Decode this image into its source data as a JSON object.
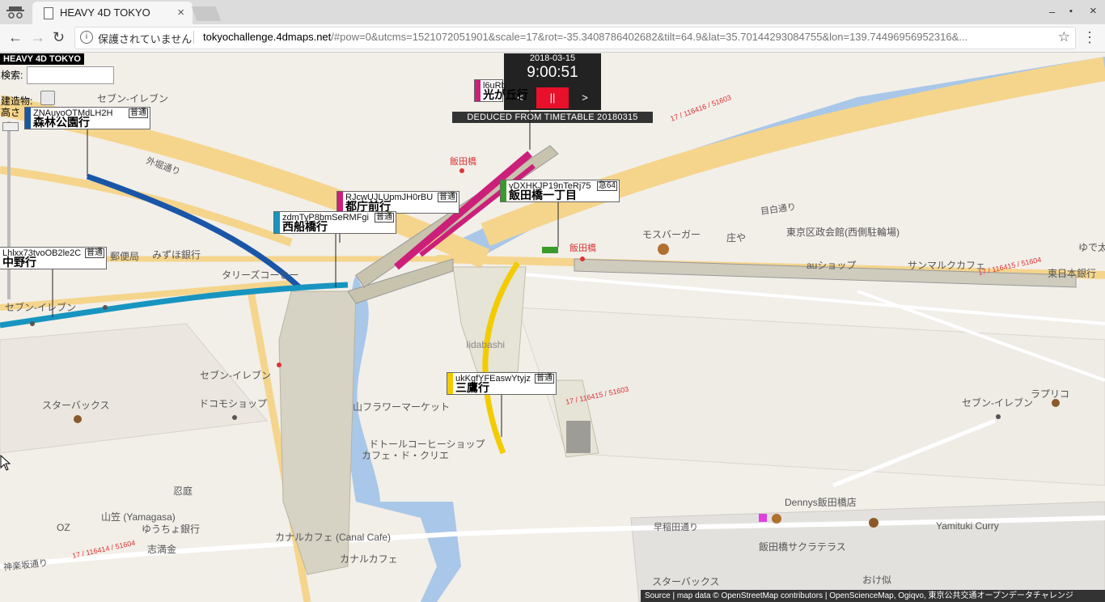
{
  "browser": {
    "tab_title": "HEAVY 4D TOKYO",
    "tab_close": "×",
    "security_label": "保護されていません",
    "url_host": "tokyochallenge.4dmaps.net",
    "url_rest": "/#pow=0&utcms=1521072051901&scale=17&rot=-35.3408786402682&tilt=64.9&lat=35.70144293084755&lon=139.74496956952316&...",
    "window_minimize": "–",
    "window_maximize": "▪",
    "window_close": "×"
  },
  "app": {
    "title": "HEAVY 4D TOKYO",
    "search_label": "検索:",
    "search_value": "",
    "buildings_label": "建造物:",
    "height_label": "高さ"
  },
  "clock": {
    "date": "2018-03-15",
    "time": "9:00:51",
    "prev": "<",
    "pause": "||",
    "next": ">",
    "source_note": "DEDUCED FROM TIMETABLE 20180315"
  },
  "trains": [
    {
      "code": "ZNAuyoOTMdLH2H",
      "kind": "普通",
      "dest": "森林公園行",
      "color": "#1a56a8"
    },
    {
      "code": "l6uRb",
      "kind": "普通",
      "dest": "光が丘行",
      "color": "#cc1f7a"
    },
    {
      "code": "RJcwUJLUpmJH0rBU",
      "kind": "普通",
      "dest": "都庁前行",
      "color": "#cc1f7a"
    },
    {
      "code": "vDXHKJP19nTeRj75",
      "kind": "急64",
      "dest": "飯田橋一丁目",
      "color": "#3a9a2a"
    },
    {
      "code": "zdmTyP8bmSeRMFgi",
      "kind": "普通",
      "dest": "西船橋行",
      "color": "#1795c0"
    },
    {
      "code": "Lhlxx73tvoOB2le2C",
      "kind": "普通",
      "dest": "中野行",
      "color": "#1795c0"
    },
    {
      "code": "ukKgfYFEaswYtyjz",
      "kind": "普通",
      "dest": "三鷹行",
      "color": "#f2cc00"
    }
  ],
  "map_labels": {
    "seven1": "セブン-イレブン",
    "iidabashi_station": "飯田橋",
    "iidabashi_station2": "飯田橋",
    "mizuho": "みずほ銀行",
    "post_office": "郵便局",
    "tullys": "タリーズコーヒー",
    "seven2": "セブン-イレブン",
    "mos": "モスバーガー",
    "shoya": "庄や",
    "koto_parking": "東京区政会館(西側駐輪場)",
    "au": "auショップ",
    "summit": "サンマルクカフェ",
    "yude": "ゆで太",
    "higashinihon": "東日本銀行",
    "iidabashi_en": "Iidabashi",
    "seven3": "セブン-イレブン",
    "docomo": "ドコモショップ",
    "starbucks1": "スターバックス",
    "yamaflower": "山フラワーマーケット",
    "doutor": "ドトールコーヒーショップ",
    "cafe_dokure": "カフェ・ド・クリエ",
    "seven4": "セブン-イレブン",
    "rapurico": "ラプリコ",
    "ninki": "忍庭",
    "yamagasa": "山笠 (Yamagasa)",
    "yucho": "ゆうちょ銀行",
    "oz": "OZ",
    "shikanen": "志満金",
    "canal_cafe": "カナルカフェ (Canal Cafe)",
    "canal_cafe2": "カナルカフェ",
    "dennys": "Dennys飯田橋店",
    "yamituki": "Yamituki Curry",
    "sakura": "飯田橋サクラテラス",
    "starbucks2": "スターバックス",
    "okeya": "おけ似",
    "waseda": "早稲田通り",
    "kagurazaka": "神楽坂通り",
    "sotobori": "外堀通り",
    "mejiro": "目白通り",
    "route_a": "17 / 116415 / 51604",
    "route_b": "17 / 116414 / 51604",
    "route_c": "17 / 116415 / 51603",
    "route_d": "17 / 116416 / 51603"
  },
  "footer": {
    "text": "Source | map data © OpenStreetMap contributors | OpenScienceMap, Ogiqvo, 東京公共交通オープンデータチャレンジ"
  }
}
